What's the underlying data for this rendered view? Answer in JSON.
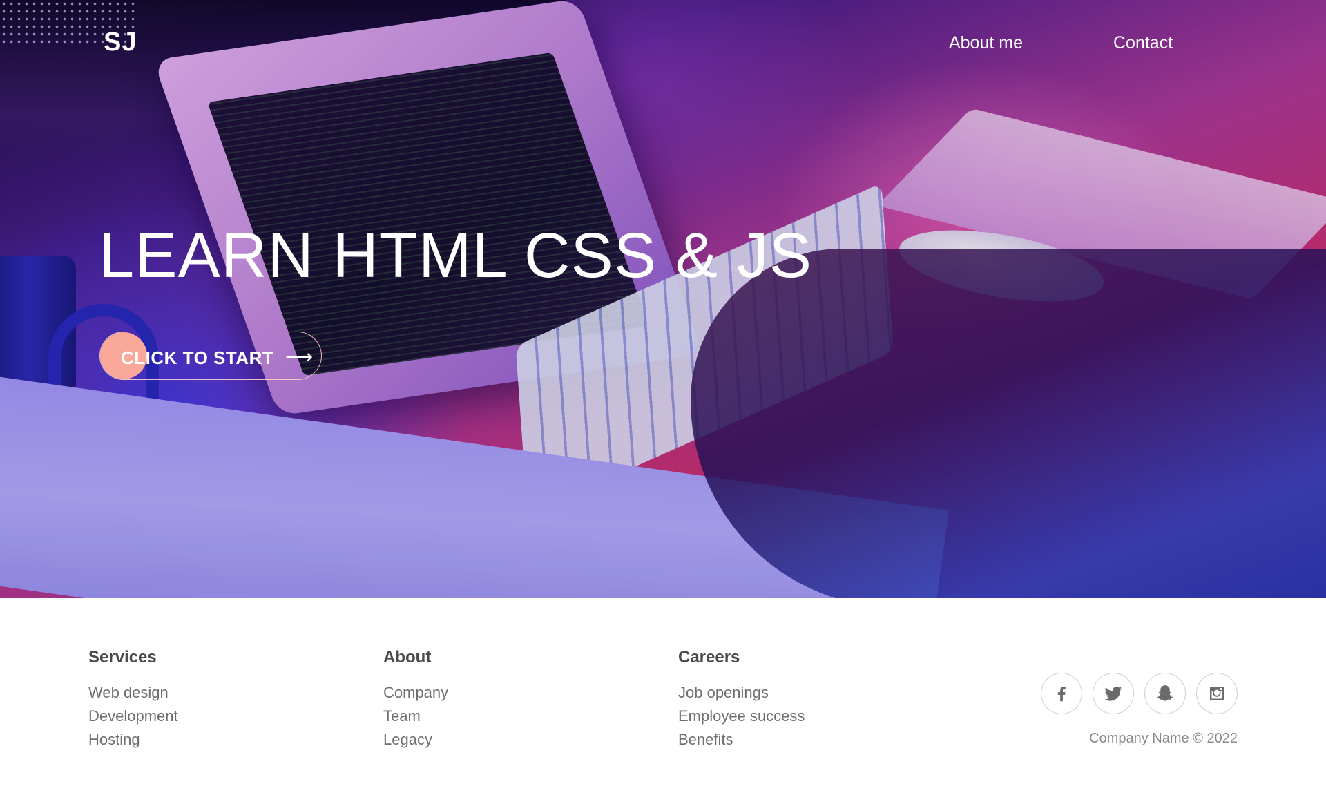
{
  "header": {
    "logo": "SJ",
    "nav": [
      {
        "label": "About me"
      },
      {
        "label": "Contact"
      }
    ]
  },
  "hero": {
    "title": "LEARN HTML CSS & JS",
    "cta_label": "CLICK TO START",
    "cta_arrow": "⟶",
    "accent_color": "#f9a89a"
  },
  "footer": {
    "columns": [
      {
        "heading": "Services",
        "links": [
          "Web design",
          "Development",
          "Hosting"
        ]
      },
      {
        "heading": "About",
        "links": [
          "Company",
          "Team",
          "Legacy"
        ]
      },
      {
        "heading": "Careers",
        "links": [
          "Job openings",
          "Employee success",
          "Benefits"
        ]
      }
    ],
    "socials": [
      {
        "icon": "facebook-icon"
      },
      {
        "icon": "twitter-icon"
      },
      {
        "icon": "snapchat-icon"
      },
      {
        "icon": "instagram-icon"
      }
    ],
    "copyright": "Company Name © 2022"
  }
}
